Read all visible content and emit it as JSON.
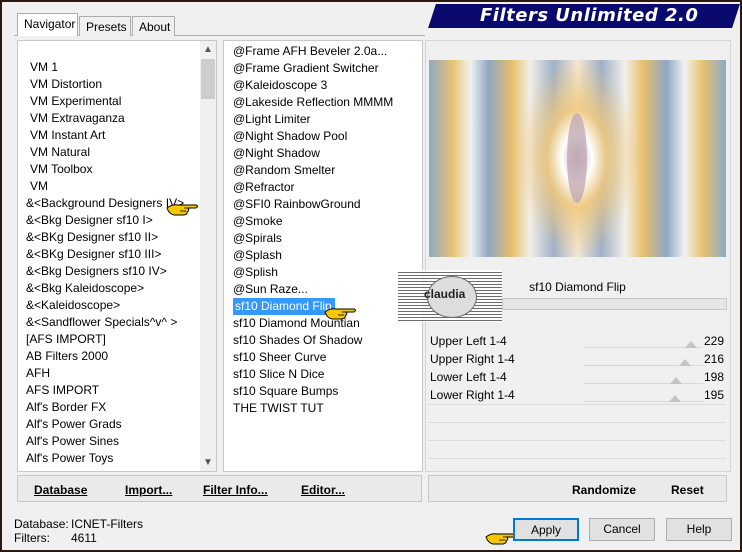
{
  "banner": {
    "title": "Filters Unlimited 2.0"
  },
  "tabs": [
    {
      "label": "Navigator"
    },
    {
      "label": "Presets"
    },
    {
      "label": "About"
    }
  ],
  "categories": [
    "VM 1",
    "VM Distortion",
    "VM Experimental",
    "VM Extravaganza",
    "VM Instant Art",
    "VM Natural",
    "VM Toolbox",
    "VM",
    "&<Background Designers IV>",
    "&<Bkg Designer sf10 I>",
    "&<BKg Designer sf10 II>",
    "&<BKg Designer sf10 III>",
    "&<Bkg Designers sf10 IV>",
    "&<Bkg Kaleidoscope>",
    "&<Kaleidoscope>",
    "&<Sandflower Specials^v^ >",
    "[AFS IMPORT]",
    "AB Filters 2000",
    "AFH",
    "AFS IMPORT",
    "Alf's Border FX",
    "Alf's Power Grads",
    "Alf's Power Sines",
    "Alf's Power Toys"
  ],
  "filters": [
    "@Frame AFH Beveler 2.0a...",
    "@Frame Gradient Switcher",
    "@Kaleidoscope 3",
    "@Lakeside Reflection MMMM",
    "@Light Limiter",
    "@Night Shadow Pool",
    "@Night Shadow",
    "@Random Smelter",
    "@Refractor",
    "@SFI0 RainbowGround",
    "@Smoke",
    "@Spirals",
    "@Splash",
    "@Splish",
    "@Sun Raze...",
    "sf10 Diamond Flip",
    "sf10 Diamond Mountian",
    "sf10 Shades Of Shadow",
    "sf10 Sheer Curve",
    "sf10 Slice N Dice",
    "sf10 Square Bumps",
    "THE TWIST TUT"
  ],
  "selected_filter": "sf10 Diamond Flip",
  "highlighted_category": "&<Background Designers IV>",
  "filter_name": "sf10 Diamond Flip",
  "watermark": "claudia",
  "sliders": [
    {
      "label": "Upper Left 1-4",
      "value": "229"
    },
    {
      "label": "Upper Right 1-4",
      "value": "216"
    },
    {
      "label": "Lower Left 1-4",
      "value": "198"
    },
    {
      "label": "Lower Right 1-4",
      "value": "195"
    }
  ],
  "toolbar": {
    "database": "Database",
    "import": "Import...",
    "filter_info": "Filter Info...",
    "editor": "Editor...",
    "randomize": "Randomize",
    "reset": "Reset"
  },
  "status": {
    "database_label": "Database:",
    "database_value": "ICNET-Filters",
    "filters_label": "Filters:",
    "filters_value": "4611"
  },
  "buttons": {
    "apply": "Apply",
    "cancel": "Cancel",
    "help": "Help"
  },
  "colors": {
    "banner": "#0a0a6e",
    "selection": "#3399ff",
    "hand": "#f5c800"
  }
}
